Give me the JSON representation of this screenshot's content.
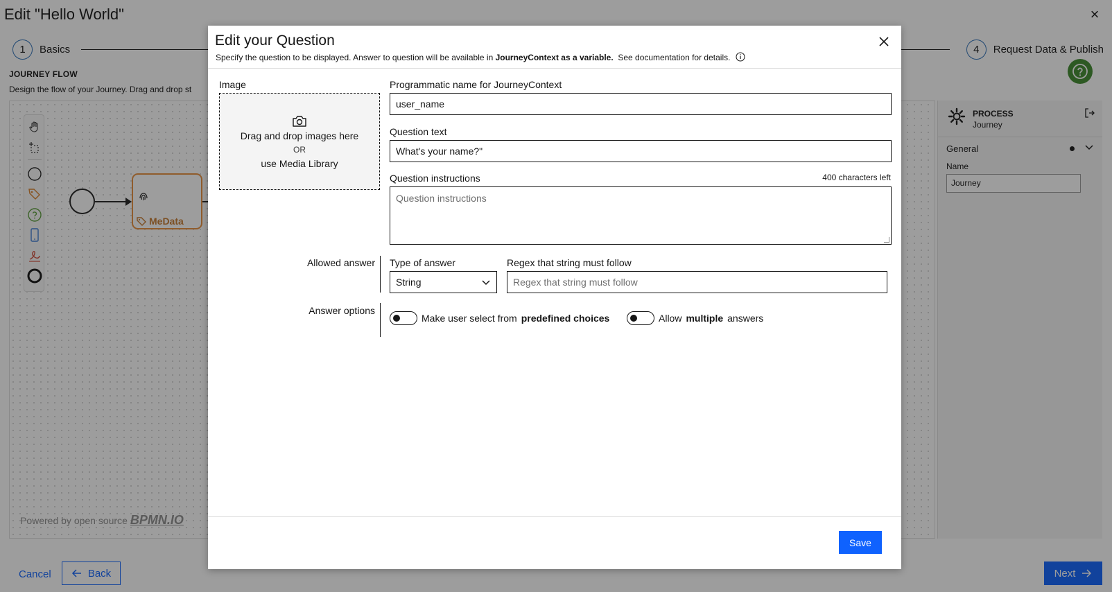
{
  "page": {
    "title": "Edit \"Hello World\"",
    "close_icon": "×",
    "steps": [
      {
        "number": "1",
        "label": "Basics"
      },
      {
        "number": "4",
        "label": "Request Data & Publish"
      }
    ],
    "journey_flow_heading": "JOURNEY FLOW",
    "journey_flow_description": "Design the flow of your Journey. Drag and drop st",
    "powered_by": "Powered by open source",
    "powered_by_brand": "BPMN.IO",
    "task_label": "MeData",
    "properties_panel": {
      "title": "PROCESS",
      "subtitle": "Journey",
      "group_label": "General",
      "name_label": "Name",
      "name_value": "Journey"
    },
    "bottom_nav": {
      "cancel": "Cancel",
      "back": "Back",
      "next": "Next"
    }
  },
  "modal": {
    "title": "Edit your Question",
    "subtitle_prefix": "Specify the question to be displayed. Answer to question will be available in",
    "subtitle_bold": "JourneyContext as a variable.",
    "subtitle_suffix": "See documentation for details.",
    "image_label": "Image",
    "dropzone": {
      "main": "Drag and drop images here",
      "or": "OR",
      "library": "use Media Library"
    },
    "programmatic_name_label": "Programmatic name for JourneyContext",
    "programmatic_name_value": "user_name",
    "question_text_label": "Question text",
    "question_text_value": "What's your name?\"",
    "instructions_label": "Question instructions",
    "instructions_count": "400 characters left",
    "instructions_placeholder": "Question instructions",
    "allowed_answer_label": "Allowed answer",
    "type_of_answer_label": "Type of answer",
    "type_of_answer_value": "String",
    "regex_label": "Regex that string must follow",
    "regex_placeholder": "Regex that string must follow",
    "answer_options_label": "Answer options",
    "toggle_predefined": {
      "prefix": "Make user select from",
      "bold": "predefined choices",
      "suffix": "",
      "checked": false
    },
    "toggle_multiple": {
      "prefix": "Allow",
      "bold": "multiple",
      "suffix": "answers",
      "checked": false
    },
    "save_label": "Save"
  },
  "colors": {
    "primary": "#0f62fe",
    "help_green": "#3f8a2e",
    "task_orange": "#e8903d",
    "overlay": "rgba(22,22,22,0.42)"
  },
  "icons": {
    "close": "close-icon",
    "camera": "camera-icon",
    "info": "info-icon",
    "chevron": "chevron-down-icon",
    "help": "help-icon",
    "gear": "gear-icon",
    "arrow_left": "arrow-left-icon",
    "arrow_right": "arrow-right-icon"
  }
}
